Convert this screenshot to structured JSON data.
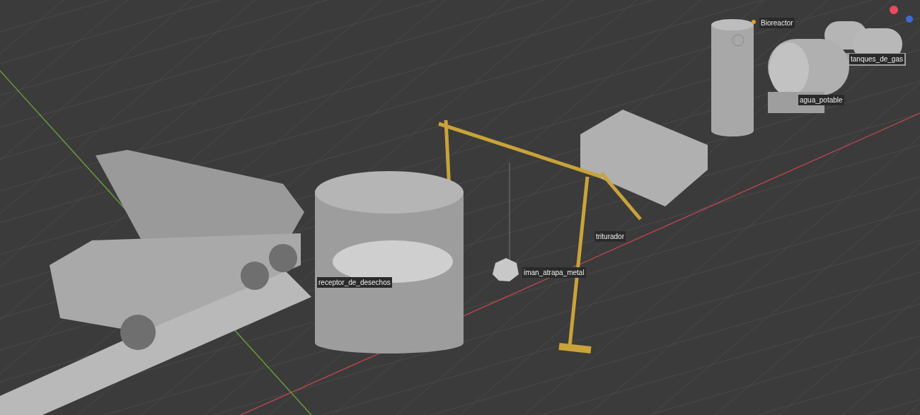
{
  "viewport": {
    "objects": [
      {
        "label": "Bioreactor",
        "kind": "vertical-tank"
      },
      {
        "label": "tanques_de_gas",
        "kind": "gas-tanks"
      },
      {
        "label": "agua_potable",
        "kind": "water-tank"
      },
      {
        "label": "triturador",
        "kind": "crane"
      },
      {
        "label": "iman_atrapa_metal",
        "kind": "magnet"
      },
      {
        "label": "receptor_de_desechos",
        "kind": "bin"
      }
    ]
  }
}
